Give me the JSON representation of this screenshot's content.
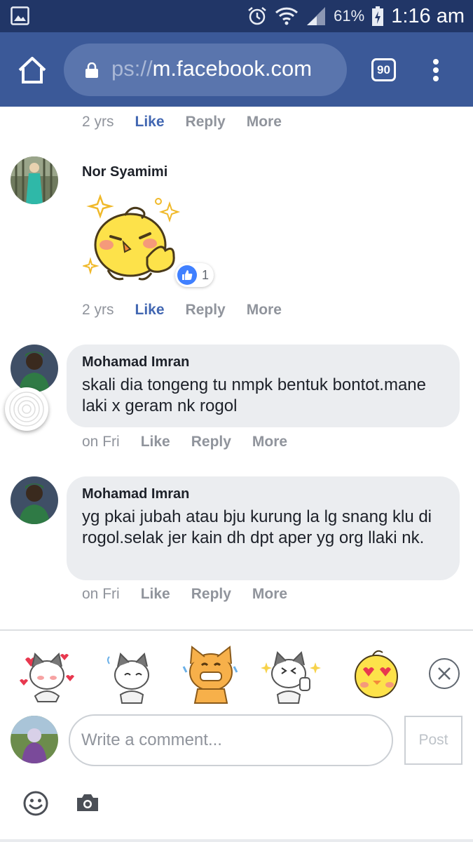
{
  "status_bar": {
    "battery": "61%",
    "time": "1:16 am"
  },
  "browser": {
    "url_prefix": "ps://",
    "url_host": "m.facebook.com",
    "tab_count": "90"
  },
  "top_row": {
    "time": "2 yrs",
    "like": "Like",
    "reply": "Reply",
    "more": "More"
  },
  "comments": [
    {
      "author": "Nor Syamimi",
      "text": "",
      "reaction_count": "1",
      "time": "2 yrs",
      "like": "Like",
      "reply": "Reply",
      "more": "More"
    },
    {
      "author": "Mohamad Imran",
      "text": "skali dia tongeng tu nmpk bentuk bontot.mane laki x geram nk rogol",
      "time": "on Fri",
      "like": "Like",
      "reply": "Reply",
      "more": "More"
    },
    {
      "author": "Mohamad Imran",
      "text": "yg pkai jubah atau bju kurung la lg snang klu di rogol.selak jer kain dh dpt aper yg org llaki nk.",
      "time": "on Fri",
      "like": "Like",
      "reply": "Reply",
      "more": "More"
    }
  ],
  "composer": {
    "placeholder": "Write a comment...",
    "post_label": "Post"
  },
  "colors": {
    "status_bar": "#213667",
    "browser_bar": "#3b5998",
    "like_blue": "#4267b2",
    "bubble": "#ebedf0"
  }
}
